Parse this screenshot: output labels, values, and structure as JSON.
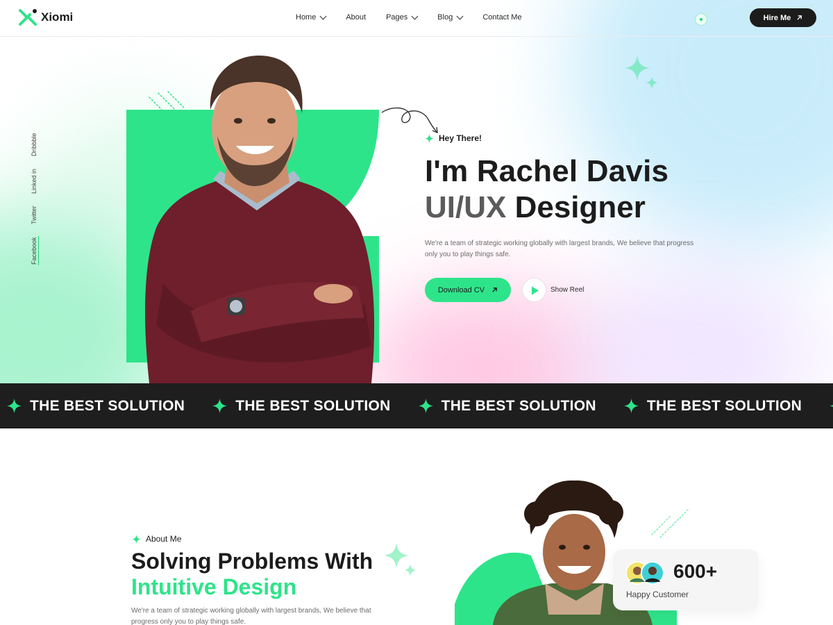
{
  "brand": {
    "name": "Xiomi",
    "accent": "#2ee48a",
    "dark": "#1c1c1c"
  },
  "nav": {
    "items": [
      {
        "label": "Home",
        "dropdown": true
      },
      {
        "label": "About",
        "dropdown": false
      },
      {
        "label": "Pages",
        "dropdown": true
      },
      {
        "label": "Blog",
        "dropdown": true
      },
      {
        "label": "Contact Me",
        "dropdown": false
      }
    ],
    "hire_label": "Hire Me"
  },
  "social": [
    "Facebook",
    "Twitter",
    "Linked in",
    "Dribbble"
  ],
  "hero": {
    "greeting": "Hey There!",
    "title_line1": "I'm Rachel Davis",
    "title_line2_part1": "UI/UX",
    "title_line2_part2": "Designer",
    "description": "We're a team of strategic working globally with largest brands, We believe that progress only you to play things safe.",
    "download_label": "Download CV",
    "reel_label": "Show Reel"
  },
  "marquee": {
    "text": "THE BEST SOLUTION",
    "repeat": 5
  },
  "about": {
    "tag": "About Me",
    "heading_line1": "Solving Problems With",
    "heading_line2": "Intuitive Design",
    "description": "We're a team of strategic working globally with largest brands, We believe that progress only you to play things safe."
  },
  "stat": {
    "value": "600+",
    "label": "Happy Customer"
  }
}
